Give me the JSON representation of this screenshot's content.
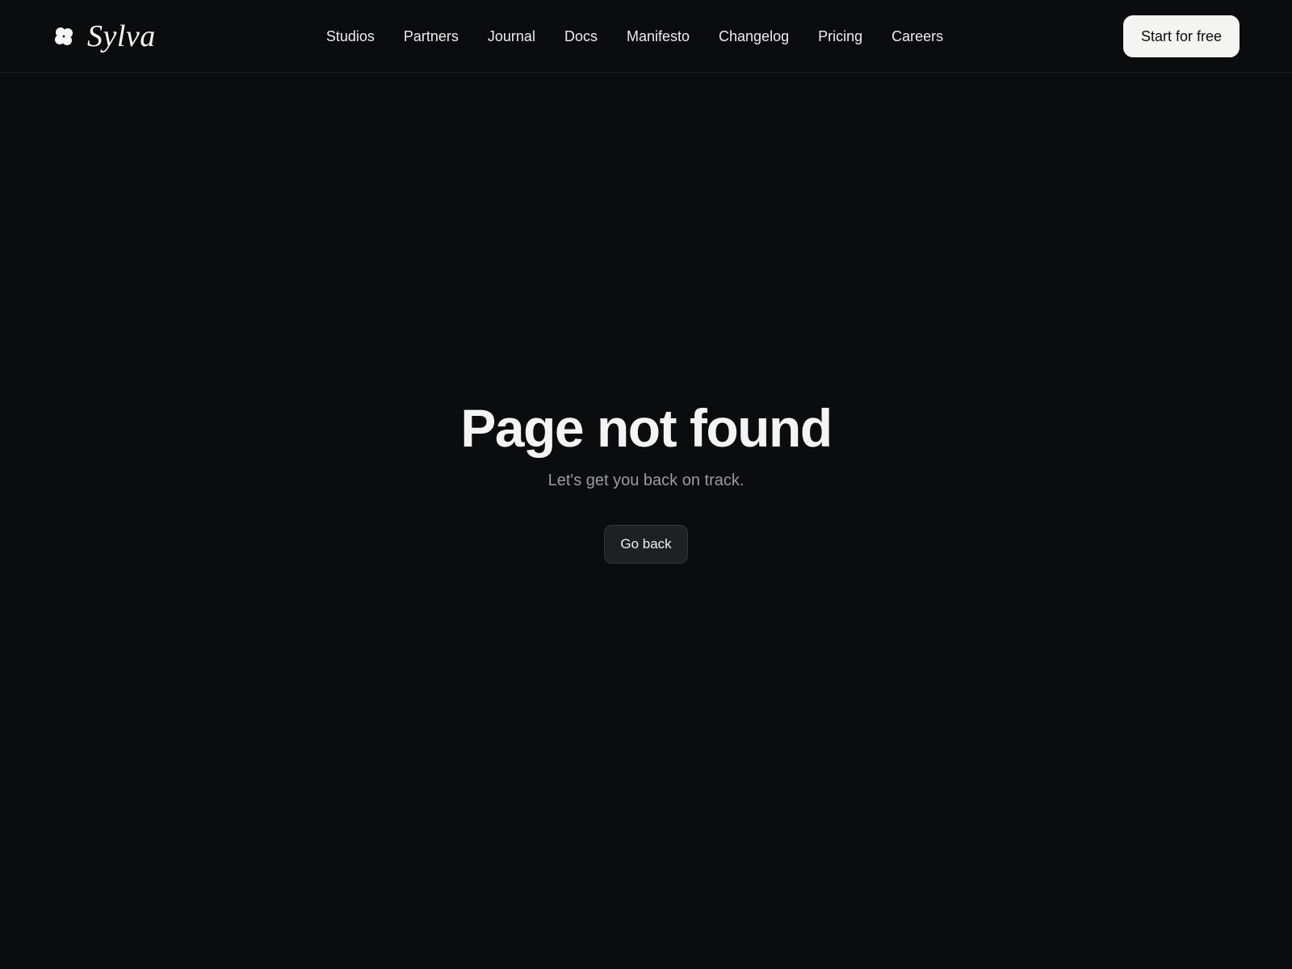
{
  "header": {
    "logo": {
      "text": "Sylva",
      "icon": "clover-icon"
    },
    "nav": [
      {
        "label": "Studios"
      },
      {
        "label": "Partners"
      },
      {
        "label": "Journal"
      },
      {
        "label": "Docs"
      },
      {
        "label": "Manifesto"
      },
      {
        "label": "Changelog"
      },
      {
        "label": "Pricing"
      },
      {
        "label": "Careers"
      }
    ],
    "cta_label": "Start for free"
  },
  "main": {
    "title": "Page not found",
    "subtitle": "Let's get you back on track.",
    "back_label": "Go back"
  },
  "colors": {
    "background": "#0a0c0e",
    "cta_background": "#f4f4f2",
    "button_background": "#1f2023",
    "muted_text": "#9a9c9f"
  }
}
